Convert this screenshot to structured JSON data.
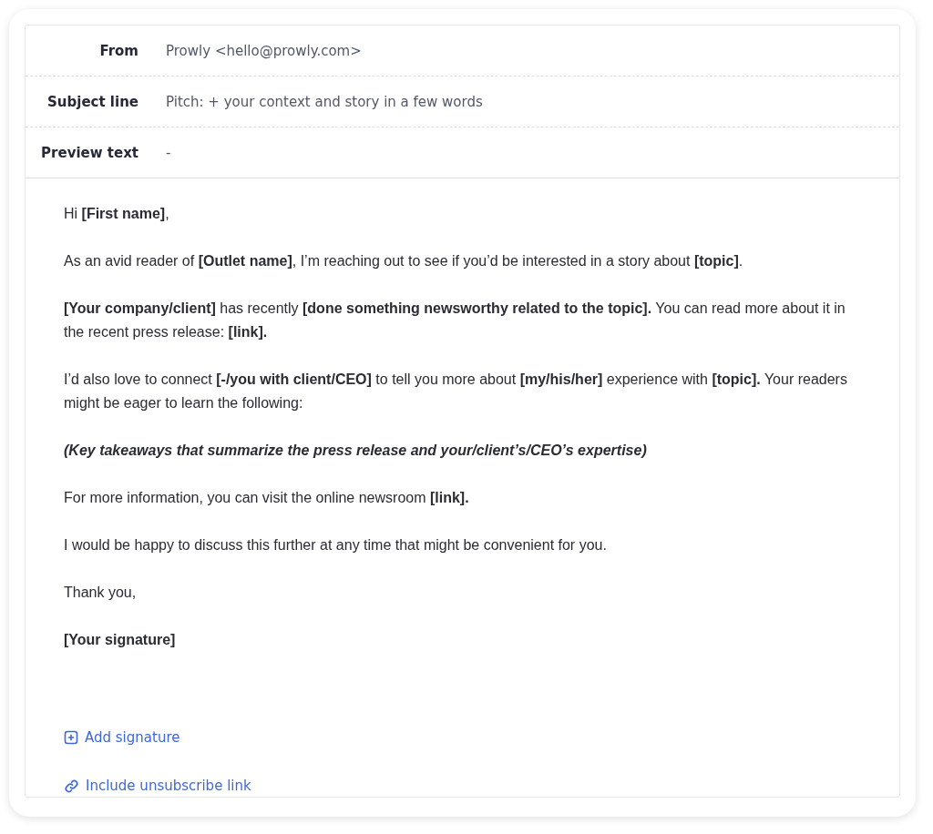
{
  "header_fields": [
    {
      "label": "From",
      "value": "Prowly <hello@prowly.com>"
    },
    {
      "label": "Subject line",
      "value": "Pitch: + your context and story in a few words"
    },
    {
      "label": "Preview text",
      "value": "-"
    }
  ],
  "body": [
    {
      "kind": "plain",
      "text": "Hi **[First name]**,"
    },
    {
      "kind": "plain",
      "text": "As an avid reader of **[Outlet name]**, I’m reaching out to see if you’d be interested in a story about **[topic]**."
    },
    {
      "kind": "plain",
      "text": "**[Your company/client]** has recently **[done something newsworthy related to the topic].** You can read more about it in the recent press release: **[link].**"
    },
    {
      "kind": "plain",
      "text": "I’d also love to connect **[-/you with client/CEO]** to tell you more about **[my/his/her]** experience with **[topic].** Your readers might be eager to learn the following:"
    },
    {
      "kind": "emphasis",
      "text": "(Key takeaways that summarize the press release and your/client’s/CEO’s expertise)"
    },
    {
      "kind": "plain",
      "text": "For more information, you can visit the online newsroom **[link].**"
    },
    {
      "kind": "plain",
      "text": "I would be happy to discuss this further at any time that might be convenient for you."
    },
    {
      "kind": "plain",
      "text": "Thank you,"
    },
    {
      "kind": "signature",
      "text": "[Your signature]"
    }
  ],
  "actions": [
    {
      "kind": "add",
      "label": "Add signature"
    },
    {
      "kind": "link",
      "label": "Include unsubscribe link"
    }
  ]
}
